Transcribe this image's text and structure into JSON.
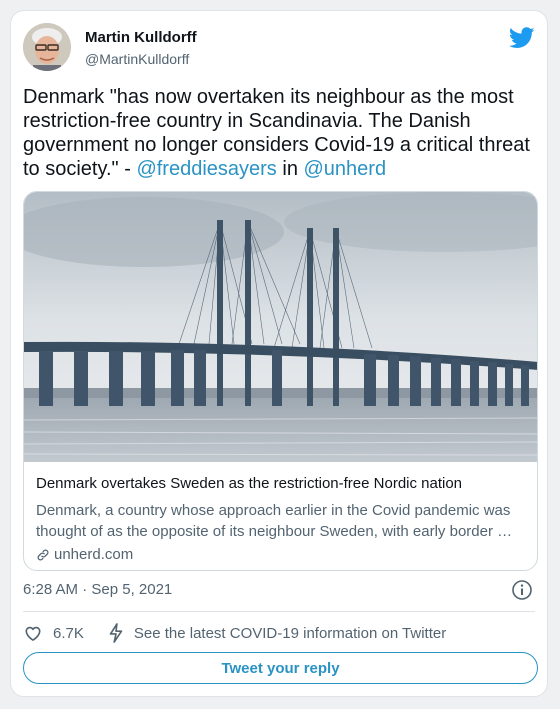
{
  "author": {
    "name": "Martin Kulldorff",
    "handle": "@MartinKulldorff"
  },
  "tweet": {
    "text_before": "Denmark \"has now overtaken its neighbour as the most restriction-free country in Scandinavia. The Danish government no longer considers Covid-19 a critical threat to society.\" - ",
    "mention1": "@freddiesayers",
    "text_between": " in ",
    "mention2": "@unherd"
  },
  "link_card": {
    "title": "Denmark overtakes Sweden as the restriction-free Nordic nation",
    "description": "Denmark, a country whose approach earlier in the Covid pandemic was thought of as the opposite of its neighbour Sweden, with early border …",
    "domain": "unherd.com"
  },
  "timestamp": "6:28 AM · Sep 5, 2021",
  "actions": {
    "likes": "6.7K",
    "covid_text": "See the latest COVID-19 information on Twitter"
  },
  "reply_button": "Tweet your reply",
  "colors": {
    "accent": "#2a93c4",
    "twitter_blue": "#1d9bf0",
    "secondary_text": "#536471"
  },
  "icons": [
    "twitter-bird-icon",
    "info-icon",
    "heart-icon",
    "lightning-icon",
    "link-icon"
  ]
}
